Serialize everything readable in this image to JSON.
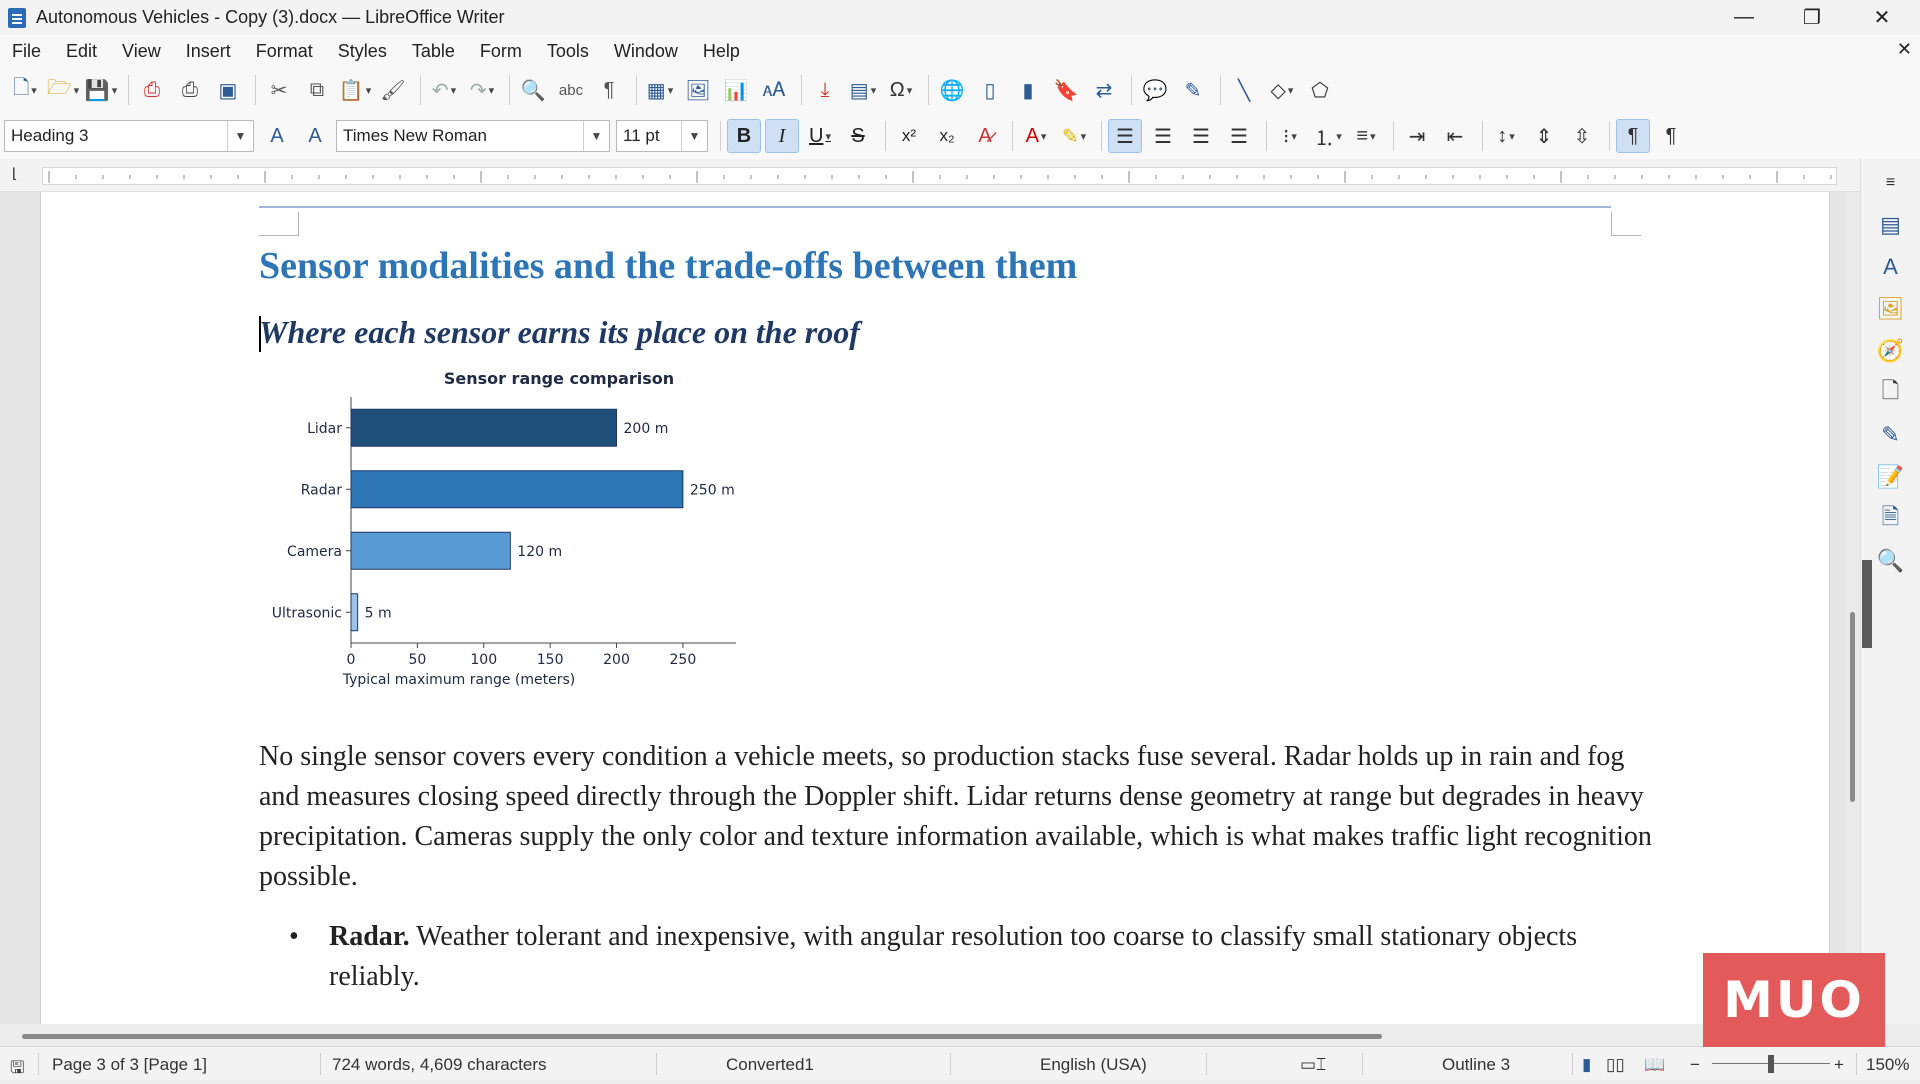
{
  "window": {
    "title": "Autonomous Vehicles - Copy (3).docx — LibreOffice Writer"
  },
  "menu": [
    "File",
    "Edit",
    "View",
    "Insert",
    "Format",
    "Styles",
    "Table",
    "Form",
    "Tools",
    "Window",
    "Help"
  ],
  "formatting": {
    "paragraph_style": "Heading 3",
    "font_name": "Times New Roman",
    "font_size": "11 pt"
  },
  "document": {
    "heading2": "Sensor modalities and the trade-offs between them",
    "heading3": "Where each sensor earns its place on the roof",
    "paragraph": "No single sensor covers every condition a vehicle meets, so production stacks fuse several. Radar holds up in rain and fog and measures closing speed directly through the Doppler shift. Lidar returns dense geometry at range but degrades in heavy precipitation. Cameras supply the only color and texture information available, which is what makes traffic light recognition possible.",
    "bullets": [
      {
        "bold": "Radar.",
        "text": " Weather tolerant and inexpensive, with angular resolution too coarse to classify small stationary objects reliably."
      }
    ]
  },
  "chart_data": {
    "type": "bar",
    "orientation": "horizontal",
    "title": "Sensor range comparison",
    "xlabel": "Typical maximum range (meters)",
    "ylabel": "",
    "categories": [
      "Lidar",
      "Radar",
      "Camera",
      "Ultrasonic"
    ],
    "values": [
      200,
      250,
      120,
      5
    ],
    "data_labels": [
      "200 m",
      "250 m",
      "120 m",
      "5 m"
    ],
    "colors": [
      "#1f4e79",
      "#2e75b6",
      "#5b9bd5",
      "#9dc3e6"
    ],
    "xticks": [
      "0",
      "50",
      "100",
      "150",
      "200",
      "250"
    ],
    "xlim": [
      0,
      290
    ]
  },
  "status": {
    "page": "Page 3 of 3 [Page 1]",
    "words": "724 words, 4,609 characters",
    "page_style": "Converted1",
    "language": "English (USA)",
    "outline": "Outline 3",
    "zoom": "150%"
  },
  "watermark": "MUO"
}
